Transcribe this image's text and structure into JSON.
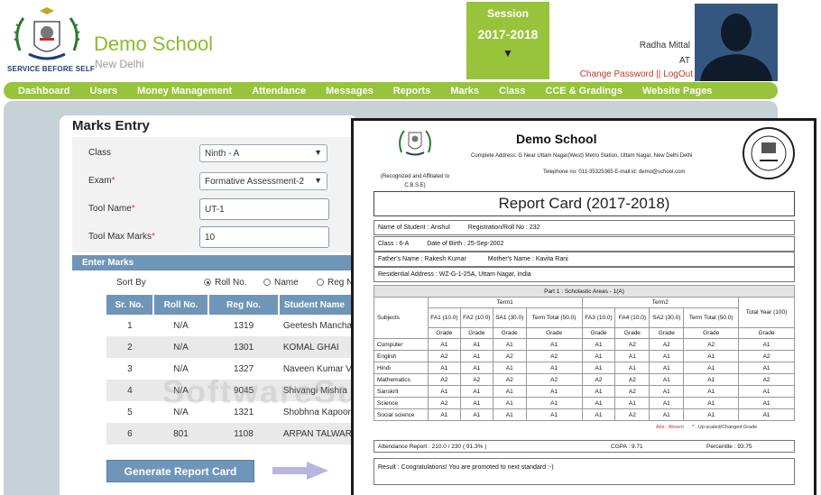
{
  "header": {
    "motto": "SERVICE BEFORE SELF",
    "school_name": "Demo School",
    "city": "New Delhi",
    "session_label": "Session",
    "session_year": "2017-2018",
    "session_caret": "▼",
    "user_name": "Radha Mittal",
    "user_role": "AT",
    "change_password": "Change Password",
    "separator": "||",
    "logout": "LogOut"
  },
  "nav": {
    "items": [
      "Dashboard",
      "Users",
      "Money Management",
      "Attendance",
      "Messages",
      "Reports",
      "Marks",
      "Class",
      "CCE & Gradings",
      "Website Pages"
    ]
  },
  "marks_entry": {
    "title": "Marks Entry",
    "class_label": "Class",
    "class_value": "Ninth - A",
    "exam_label": "Exam",
    "exam_value": "Formative Assessment-2",
    "tool_name_label": "Tool Name",
    "tool_name_value": "UT-1",
    "tool_max_label": "Tool Max Marks",
    "tool_max_value": "10",
    "required_mark": "*",
    "enter_marks": "Enter Marks",
    "sort_by": "Sort By",
    "sort_options": [
      "Roll No.",
      "Name",
      "Reg N"
    ],
    "sort_selected": "Roll No.",
    "columns": [
      "Sr. No.",
      "Roll No.",
      "Reg No.",
      "Student Name"
    ],
    "rows": [
      {
        "sr": "1",
        "roll": "N/A",
        "reg": "1319",
        "name": "Geetesh Manchar"
      },
      {
        "sr": "2",
        "roll": "N/A",
        "reg": "1301",
        "name": "KOMAL GHAI"
      },
      {
        "sr": "3",
        "roll": "N/A",
        "reg": "1327",
        "name": "Naveen Kumar Ve"
      },
      {
        "sr": "4",
        "roll": "N/A",
        "reg": "9045",
        "name": "Shivangi Mishra"
      },
      {
        "sr": "5",
        "roll": "N/A",
        "reg": "1321",
        "name": "Shobhna Kapoor"
      },
      {
        "sr": "6",
        "roll": "801",
        "reg": "1108",
        "name": "ARPAN TALWAR"
      }
    ],
    "generate_button": "Generate Report Card"
  },
  "watermark": "SoftwareSuggest.com",
  "report_card": {
    "school": "Demo School",
    "recognized": "(Recognized and Affiliated to C.B.S.E)",
    "address": "Complete Address: G  Near Uttam Nagar(West) Metro Station, Uttam Nagar, New Delhi Delhi",
    "phone": "Telephone no: 011-35325365  E-mail id: demo@school.com",
    "title": "Report Card (2017-2018)",
    "student_label": "Name of Student :",
    "student_name": "Anshul",
    "reg_label": "Registration/Roll No :",
    "reg_value": "232",
    "class_label": "Class :",
    "class_value": "6-A",
    "dob_label": "Date of Birth :",
    "dob_value": "25-Sep-2002",
    "father_label": "Father's Name :",
    "father_value": "Rakesh Kumar",
    "mother_label": "Mother's Name :",
    "mother_value": "Kavita Rani",
    "address_label": "Residential Address :",
    "address_value": "WZ-G-1-25A, Uttam Nagar, India",
    "part_title": "Part 1 :  Scholastic Areas - 1(A)",
    "subjects_label": "Subjects",
    "term1": "Term1",
    "term2": "Term2",
    "total_year": "Total Year (100)",
    "sub_columns": [
      "FA1 (10.0)",
      "FA2 (10.0)",
      "SA1 (30.0)",
      "Term Total (50.0)",
      "FA3 (10.0)",
      "FA4 (10.0)",
      "SA2 (30.0)",
      "Term Total (50.0)"
    ],
    "grade_label": "Grade",
    "grades": [
      {
        "subject": "Computer",
        "g": [
          "A1",
          "A1",
          "A1",
          "A1",
          "A1",
          "A2",
          "A2",
          "A2",
          "A1"
        ]
      },
      {
        "subject": "English",
        "g": [
          "A2",
          "A1",
          "A2",
          "A2",
          "A1",
          "A1",
          "A1",
          "A1",
          "A2"
        ]
      },
      {
        "subject": "Hindi",
        "g": [
          "A1",
          "A1",
          "A1",
          "A1",
          "A1",
          "A1",
          "A1",
          "A1",
          "A1"
        ]
      },
      {
        "subject": "Mathematics",
        "g": [
          "A2",
          "A2",
          "A2",
          "A2",
          "A2",
          "A2",
          "A1",
          "A1",
          "A2"
        ]
      },
      {
        "subject": "Sanskrit",
        "g": [
          "A1",
          "A1",
          "A1",
          "A1",
          "A1",
          "A2",
          "A1",
          "A1",
          "A1"
        ]
      },
      {
        "subject": "Science",
        "g": [
          "A2",
          "A1",
          "A1",
          "A1",
          "A1",
          "A1",
          "A1",
          "A1",
          "A1"
        ]
      },
      {
        "subject": "Social science",
        "g": [
          "A1",
          "A1",
          "A1",
          "A1",
          "A1",
          "A2",
          "A1",
          "A1",
          "A1"
        ]
      }
    ],
    "legend_abs": "Abs : Absent",
    "legend_star": "* : Up-scaled/Changed Grade",
    "attendance": "Attendance Report : 210.0 / 230 ( 91.3% )",
    "cgpa": "CGPA : 9.71",
    "percentile": "Percentile : 93.75",
    "result": "Result : Congratulations! You are promoted to next standard :-)"
  },
  "colors": {
    "brand_green": "#97c43a",
    "accent_blue": "#6f95b8",
    "link_red": "#c0392b"
  }
}
